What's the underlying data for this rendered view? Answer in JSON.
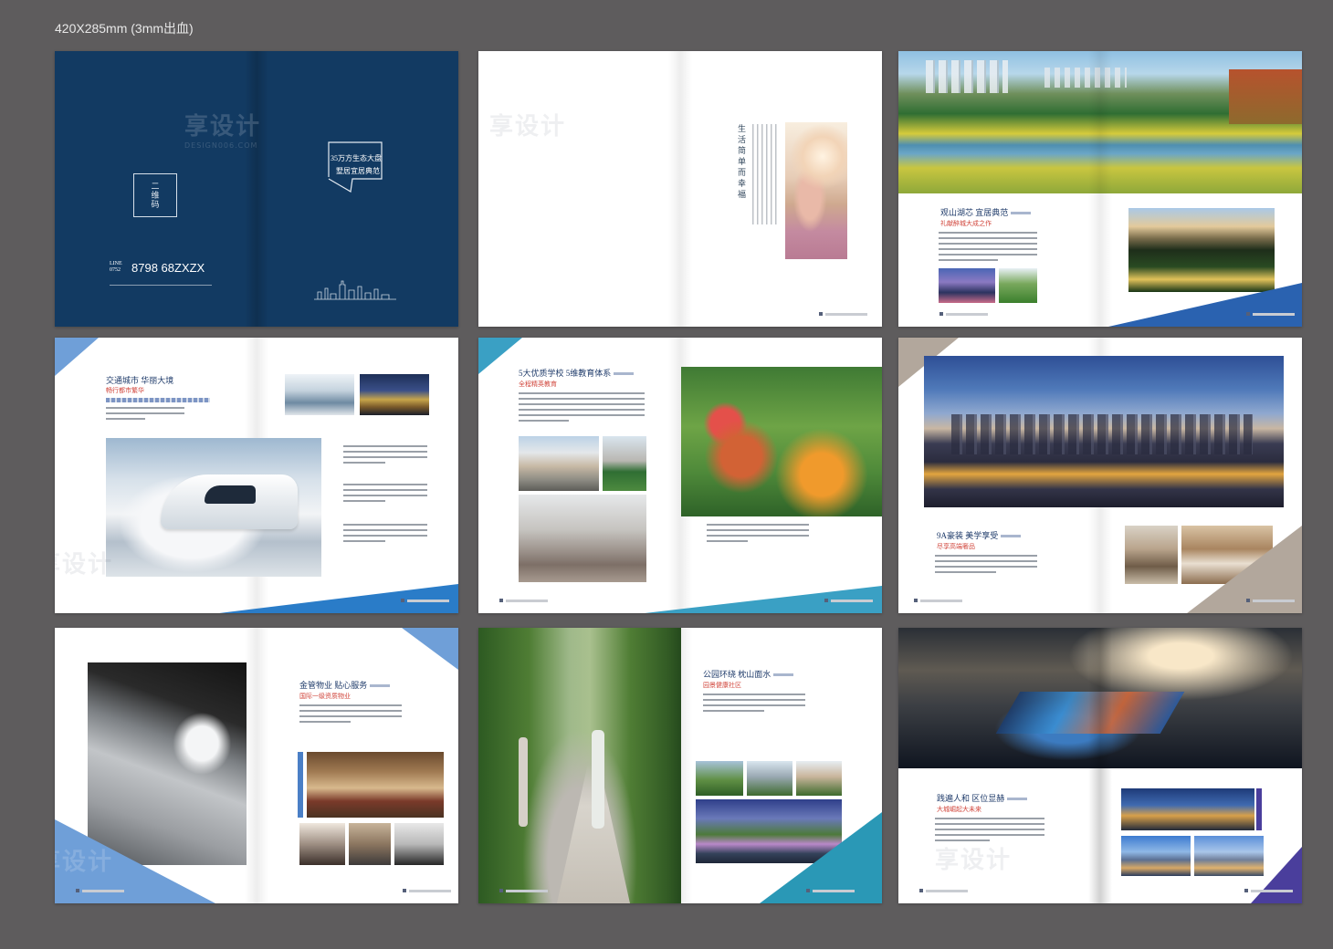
{
  "spec_label": "420X285mm (3mm出血)",
  "cover": {
    "qr_label": "二维码",
    "slogan_line1": "35万方生态大盘",
    "slogan_line2": "墅居宜居典范",
    "tel_prefix": "LINE 0752",
    "phone": "8798 68ZXZX"
  },
  "intro": {
    "vertical_title": "生活简单而幸福"
  },
  "page_scenery": {
    "heading": "观山湖芯 宜居典范",
    "subheading": "礼献醉城大成之作"
  },
  "page_transport": {
    "heading": "交通城市 华丽大境",
    "subheading": "畅行都市繁华"
  },
  "page_school": {
    "heading": "5大优质学校 5维教育体系",
    "subheading": "全程精英教育"
  },
  "page_decor": {
    "heading": "9A豪装 美学享受",
    "subheading": "尽享高端奢品"
  },
  "page_service": {
    "heading": "金管物业 贴心服务",
    "subheading": "国际一级资质物业"
  },
  "page_garden": {
    "heading": "公园环绕 枕山面水",
    "subheading": "园景健康社区"
  },
  "page_future": {
    "heading": "践遍人和 区位显赫",
    "subheading": "大城崛起大未来"
  },
  "watermark": {
    "text": "享设计",
    "url": "DESIGN006.COM"
  },
  "colors": {
    "navy": "#123a62",
    "blue": "#2a62b0",
    "teal": "#2a98b6",
    "taupe": "#b2a79c",
    "violet": "#4a3e9c"
  }
}
